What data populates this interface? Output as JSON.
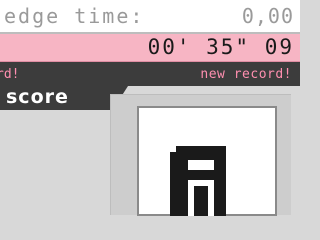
{
  "edge_time": {
    "label": "edge time:",
    "value": "0,00"
  },
  "current_time": {
    "value": "00' 35\" 09"
  },
  "records": {
    "left_text": "rd!",
    "right_text": "new record!"
  },
  "score": {
    "label": "score",
    "digit": "8"
  },
  "colors": {
    "pink_bar": "#f7b5c4",
    "record_text": "#ff8fb0",
    "dark_bar": "#3c3c3c"
  }
}
